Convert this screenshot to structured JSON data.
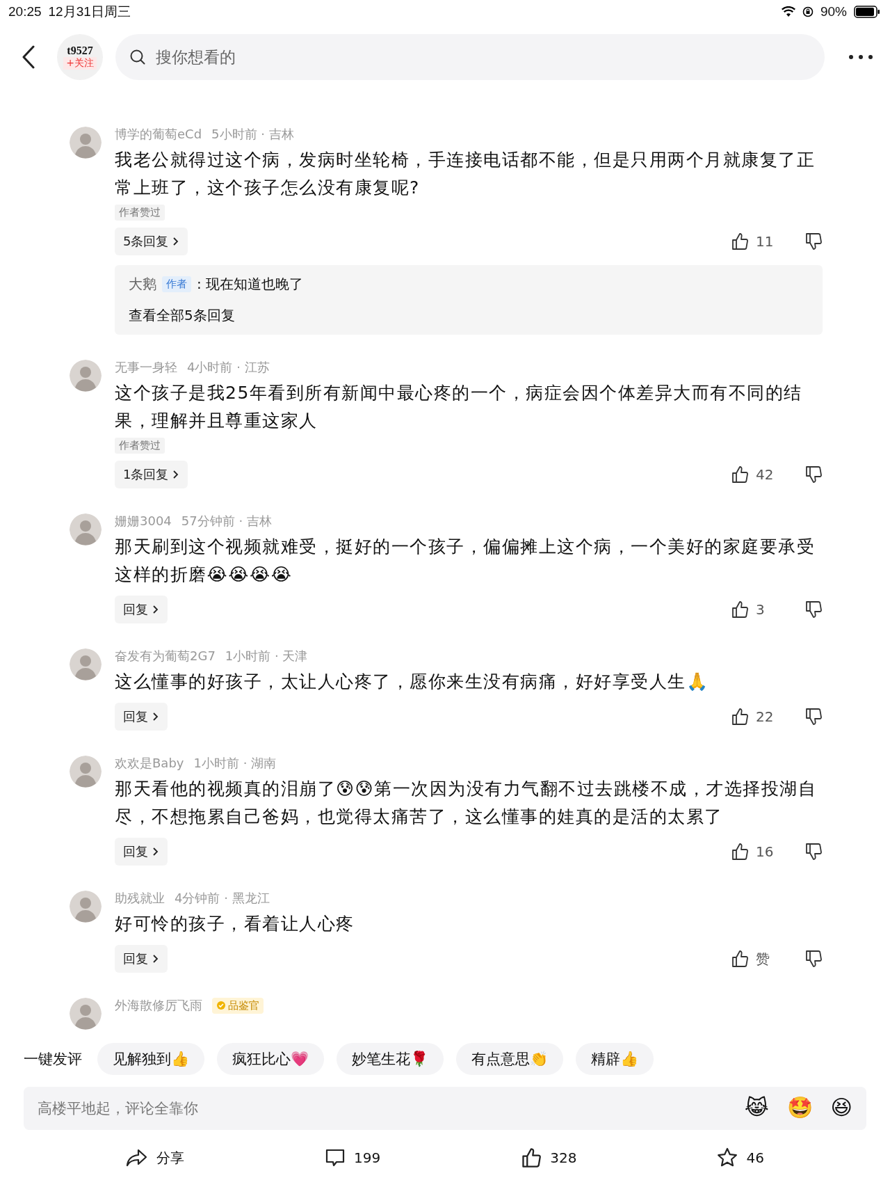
{
  "status_bar": {
    "time": "20:25",
    "date": "12月31日周三",
    "battery": "90%"
  },
  "header": {
    "account": "t9527",
    "follow": "+关注",
    "search_placeholder": "搜你想看的"
  },
  "comments": [
    {
      "user": "博学的葡萄eCd",
      "time": "5小时前 · 吉林",
      "text": "我老公就得过这个病，发病时坐轮椅，手连接电话都不能，但是只用两个月就康复了正常上班了，这个孩子怎么没有康复呢?",
      "author_liked": "作者赞过",
      "replies_button": "5条回复",
      "likes": "11",
      "reply_preview": {
        "user": "大鹅",
        "tag": "作者",
        "text": ": 现在知道也晚了",
        "more": "查看全部5条回复"
      }
    },
    {
      "user": "无事一身轻",
      "time": "4小时前 · 江苏",
      "text": "这个孩子是我25年看到所有新闻中最心疼的一个，病症会因个体差异大而有不同的结果，理解并且尊重这家人",
      "author_liked": "作者赞过",
      "replies_button": "1条回复",
      "likes": "42"
    },
    {
      "user": "姗姗3004",
      "time": "57分钟前 · 吉林",
      "text": "那天刷到这个视频就难受，挺好的一个孩子，偏偏摊上这个病，一个美好的家庭要承受这样的折磨😭😭😭😭",
      "replies_button": "回复",
      "likes": "3"
    },
    {
      "user": "奋发有为葡萄2G7",
      "time": "1小时前 · 天津",
      "text": "这么懂事的好孩子，太让人心疼了，愿你来生没有病痛，好好享受人生🙏",
      "replies_button": "回复",
      "likes": "22"
    },
    {
      "user": "欢欢是Baby",
      "time": "1小时前 · 湖南",
      "text": "那天看他的视频真的泪崩了😰😰第一次因为没有力气翻不过去跳楼不成，才选择投湖自尽，不想拖累自己爸妈，也觉得太痛苦了，这么懂事的娃真的是活的太累了",
      "replies_button": "回复",
      "likes": "16"
    },
    {
      "user": "助残就业",
      "time": "4分钟前 · 黑龙江",
      "text": "好可怜的孩子，看着让人心疼",
      "replies_button": "回复",
      "likes": "赞"
    },
    {
      "user": "外海散修厉飞雨",
      "badge": "品鉴官"
    }
  ],
  "quick_reply": {
    "label": "一键发评",
    "chips": [
      "见解独到👍",
      "疯狂比心💗",
      "妙笔生花🌹",
      "有点意思👏",
      "精辟👍"
    ]
  },
  "input": {
    "placeholder": "高楼平地起，评论全靠你",
    "emojis": [
      "😹",
      "🤩",
      "😆"
    ]
  },
  "actions": [
    {
      "kind": "share",
      "label": "分享"
    },
    {
      "kind": "comment",
      "label": "199"
    },
    {
      "kind": "like",
      "label": "328"
    },
    {
      "kind": "star",
      "label": "46"
    }
  ]
}
